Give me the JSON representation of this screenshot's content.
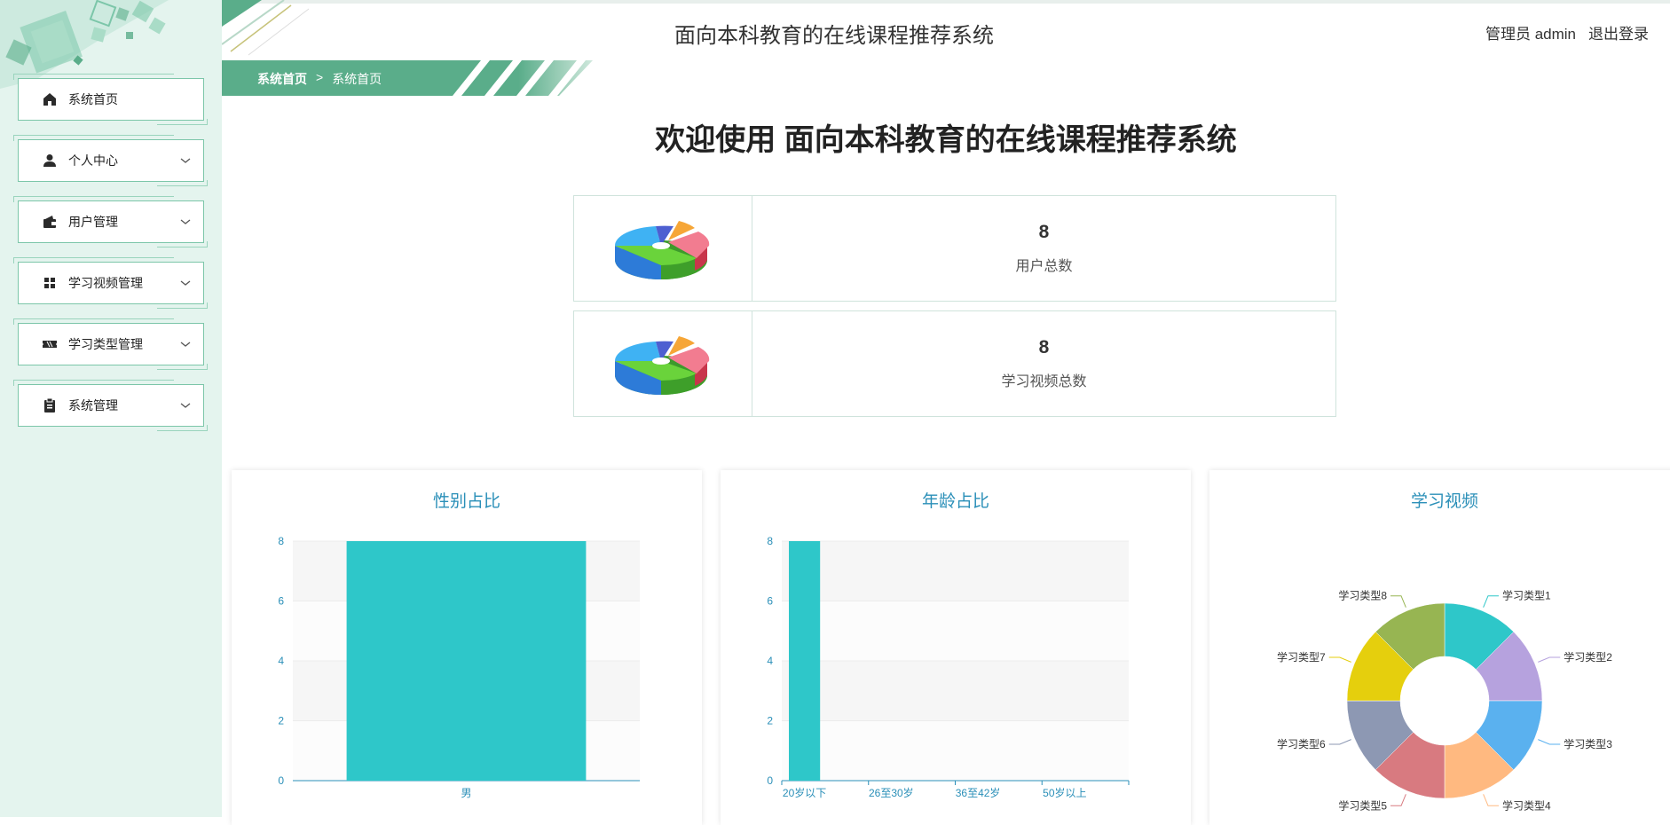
{
  "header": {
    "system_title": "面向本科教育的在线课程推荐系统",
    "role_user": "管理员 admin",
    "logout": "退出登录"
  },
  "breadcrumb": {
    "home": "系统首页",
    "separator": ">",
    "current": "系统首页"
  },
  "welcome": "欢迎使用 面向本科教育的在线课程推荐系统",
  "sidebar": {
    "items": [
      {
        "label": "系统首页",
        "icon": "home-icon",
        "has_chevron": false
      },
      {
        "label": "个人中心",
        "icon": "user-icon",
        "has_chevron": true
      },
      {
        "label": "用户管理",
        "icon": "wallet-icon",
        "has_chevron": true
      },
      {
        "label": "学习视频管理",
        "icon": "grid-icon",
        "has_chevron": true
      },
      {
        "label": "学习类型管理",
        "icon": "ticket-icon",
        "has_chevron": true
      },
      {
        "label": "系统管理",
        "icon": "clipboard-icon",
        "has_chevron": true
      }
    ]
  },
  "stats": [
    {
      "value": "8",
      "label": "用户总数",
      "icon": "pie-3d-icon"
    },
    {
      "value": "8",
      "label": "学习视频总数",
      "icon": "pie-3d-icon"
    }
  ],
  "colors": {
    "accent_green": "#5aad8a",
    "sidebar_bg": "#e4f4ee",
    "bar": "#2ec7c9",
    "title_blue": "#2a8fb8"
  },
  "chart_data": [
    {
      "type": "bar",
      "title": "性别占比",
      "categories": [
        "男"
      ],
      "values": [
        8
      ],
      "ylim": [
        0,
        8
      ],
      "yticks": [
        0,
        2,
        4,
        6,
        8
      ]
    },
    {
      "type": "bar",
      "title": "年龄占比",
      "categories": [
        "20岁以下",
        "26至30岁",
        "36至42岁",
        "50岁以上"
      ],
      "values": [
        8,
        0,
        0,
        0
      ],
      "ylim": [
        0,
        8
      ],
      "yticks": [
        0,
        2,
        4,
        6,
        8
      ]
    },
    {
      "type": "pie",
      "title": "学习视频",
      "donut": true,
      "categories": [
        "学习类型1",
        "学习类型2",
        "学习类型3",
        "学习类型4",
        "学习类型5",
        "学习类型6",
        "学习类型7",
        "学习类型8"
      ],
      "values": [
        1,
        1,
        1,
        1,
        1,
        1,
        1,
        1
      ],
      "colors": [
        "#2ec7c9",
        "#b6a2de",
        "#5ab1ef",
        "#ffb980",
        "#d87a80",
        "#8d98b3",
        "#e5cf0d",
        "#97b552"
      ]
    }
  ]
}
